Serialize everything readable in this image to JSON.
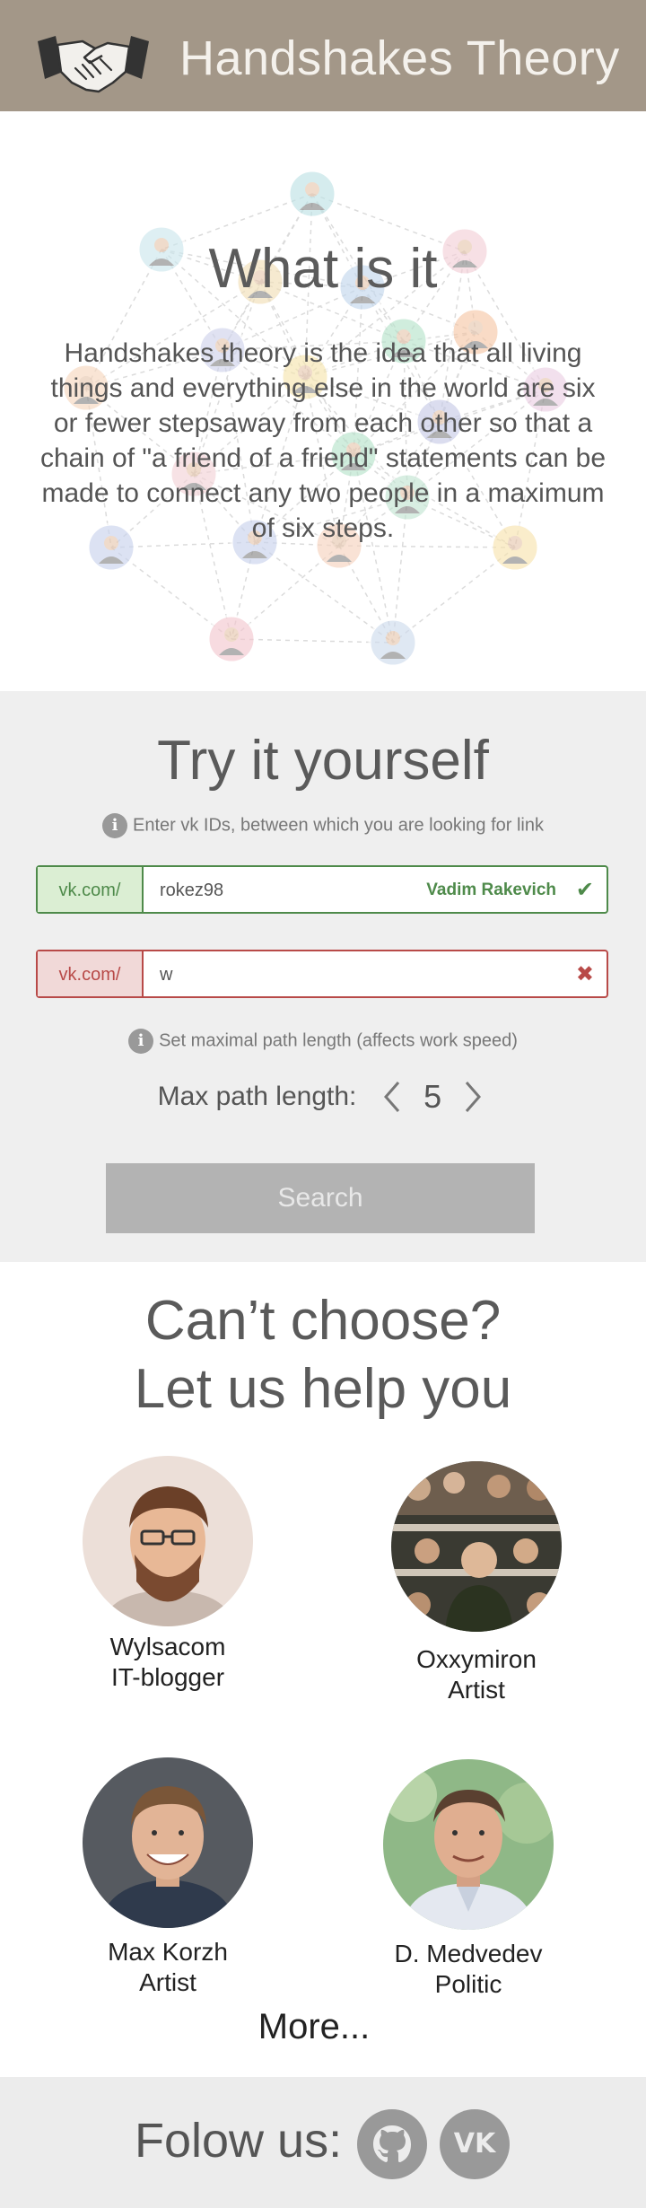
{
  "header": {
    "title": "Handshakes Theory",
    "logo_icon": "handshake-icon"
  },
  "about": {
    "title": "What is it",
    "text": "Handshakes theory is the idea that all living things and everything else in the world are six or fewer stepsaway from each other so that a chain of \"a friend of a friend\" statements can be made to connect any two people in a maximum of six steps."
  },
  "try": {
    "title": "Try it yourself",
    "hint_ids": "Enter vk IDs, between which you are looking for link",
    "field1": {
      "prefix": "vk.com/",
      "value": "rokez98",
      "resolved_name": "Vadim Rakevich",
      "status": "valid",
      "status_icon": "check-icon"
    },
    "field2": {
      "prefix": "vk.com/",
      "value": "w",
      "status": "invalid",
      "status_icon": "cross-icon"
    },
    "hint_path": "Set maximal path length (affects work speed)",
    "max_path_label": "Max path length:",
    "max_path_value": "5",
    "search_label": "Search"
  },
  "help": {
    "title_line1": "Can’t choose?",
    "title_line2": "Let us help you",
    "people": [
      {
        "name": "Wylsacom",
        "role": "IT-blogger"
      },
      {
        "name": "Oxxymiron",
        "role": "Artist"
      },
      {
        "name": "Max Korzh",
        "role": "Artist"
      },
      {
        "name": "D. Medvedev",
        "role": "Politic"
      }
    ],
    "more_label": "More..."
  },
  "footer": {
    "follow_label": "Folow us:",
    "github_icon": "github-icon",
    "vk_icon": "vk-icon",
    "vk_text": "VK"
  },
  "colors": {
    "header_bg": "#a39788",
    "valid": "#4e8a4a",
    "invalid": "#b84a48",
    "button_bg": "#b3b3b3"
  }
}
